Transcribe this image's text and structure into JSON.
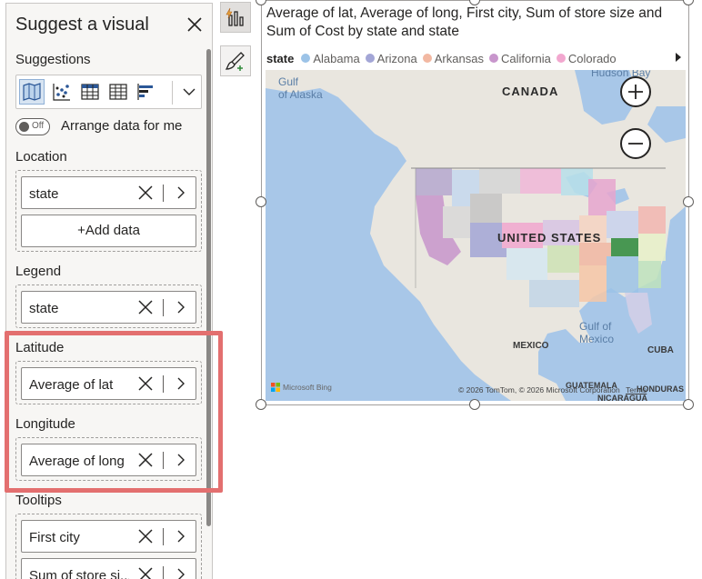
{
  "panel": {
    "title": "Suggest a visual",
    "suggestions_label": "Suggestions",
    "toggle_state": "Off",
    "toggle_label": "Arrange data for me",
    "wells": [
      {
        "label": "Location",
        "fields": [
          "state"
        ],
        "add_label": "+Add data"
      },
      {
        "label": "Legend",
        "fields": [
          "state"
        ]
      },
      {
        "label": "Latitude",
        "fields": [
          "Average of lat"
        ]
      },
      {
        "label": "Longitude",
        "fields": [
          "Average of long"
        ]
      },
      {
        "label": "Tooltips",
        "fields": [
          "First city",
          "Sum of store si..."
        ]
      }
    ]
  },
  "visual": {
    "title": "Average of lat, Average of long, First city, Sum of store size and Sum of Cost by state and state",
    "legend_title": "state",
    "legend": [
      {
        "name": "Alabama",
        "color": "#9cc3e7"
      },
      {
        "name": "Arizona",
        "color": "#a3a6d6"
      },
      {
        "name": "Arkansas",
        "color": "#f2b8a2"
      },
      {
        "name": "California",
        "color": "#c896cc"
      },
      {
        "name": "Colorado",
        "color": "#f2a7cf"
      }
    ],
    "map_labels": {
      "alaska": "Gulf\nof Alaska",
      "hudson": "Hudson Bay",
      "canada": "CANADA",
      "us": "UNITED STATES",
      "gulf_mexico": "Gulf of\nMexico",
      "mexico": "MEXICO",
      "cuba": "CUBA",
      "guatemala": "GUATEMALA",
      "honduras": "HONDURAS",
      "nicaragua": "NICARAGUA"
    },
    "copyright": "© 2026 TomTom, © 2026 Microsoft Corporation",
    "terms": "Terms",
    "bing": "Microsoft Bing"
  }
}
